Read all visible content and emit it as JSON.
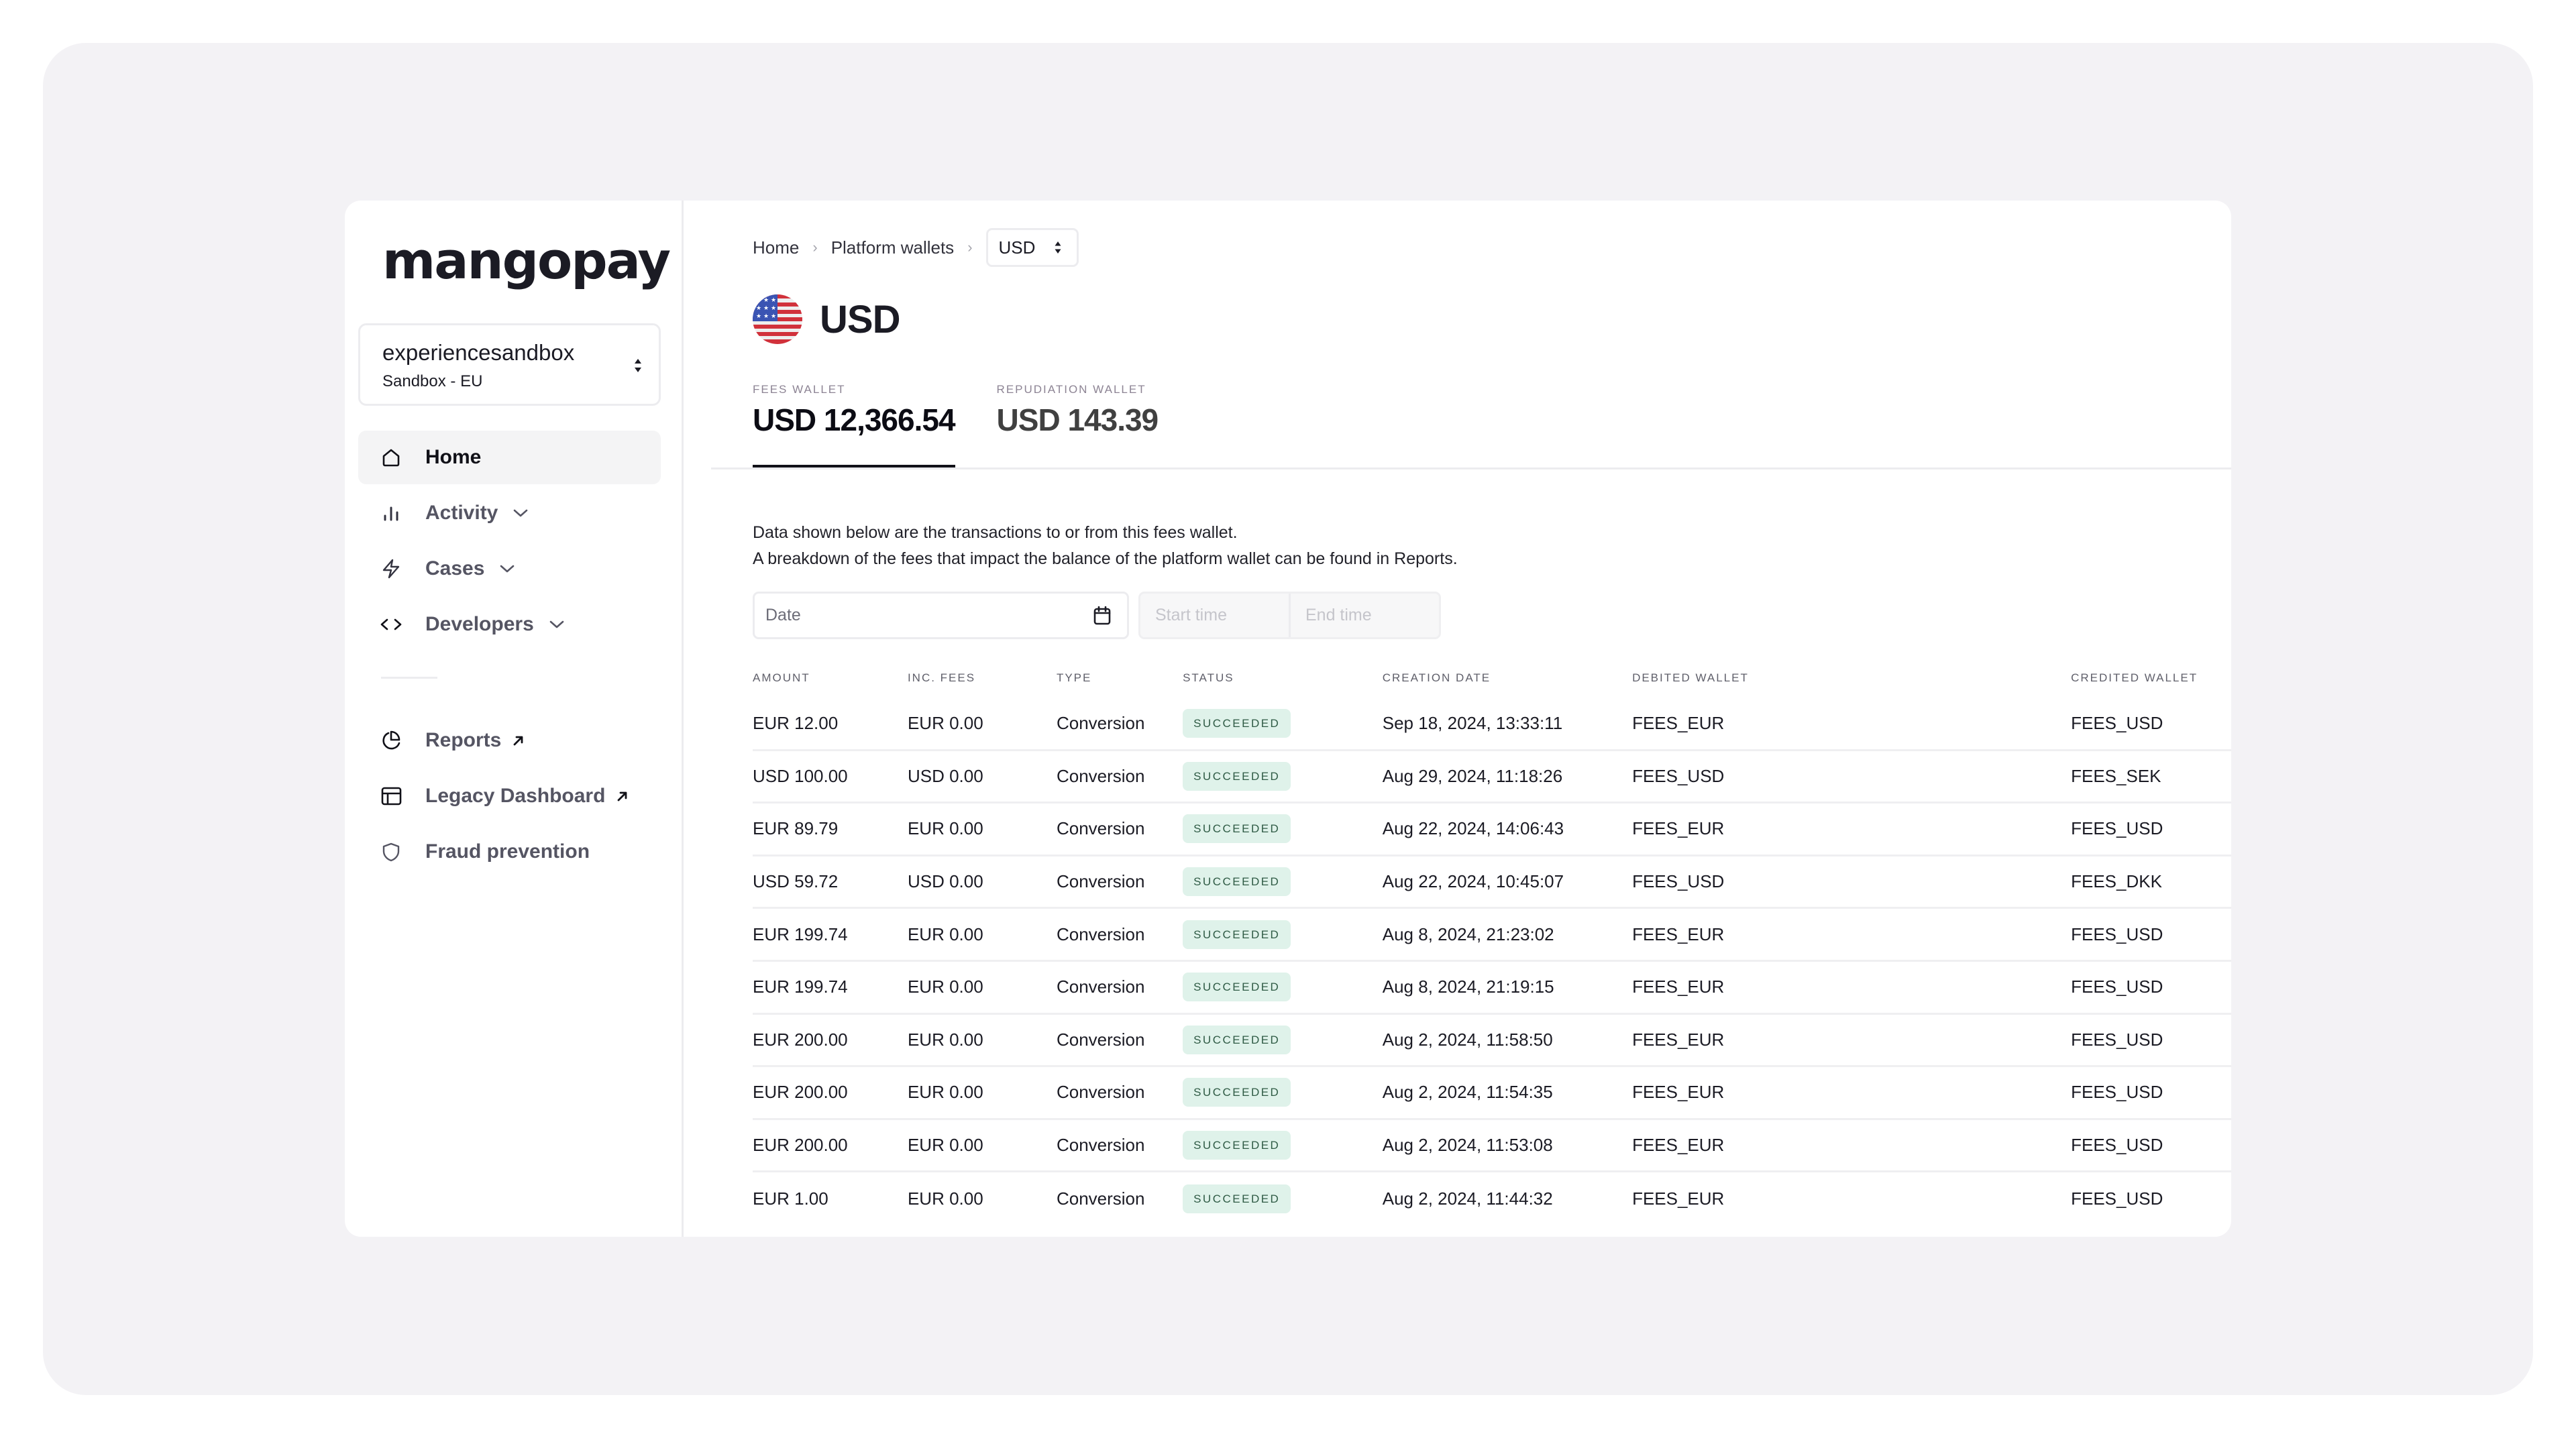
{
  "brand": {
    "logo_text": "mangopay"
  },
  "environment": {
    "name": "experiencesandbox",
    "region": "Sandbox - EU"
  },
  "sidebar": {
    "items": [
      {
        "label": "Home",
        "icon": "home-icon",
        "active": true,
        "expandable": false,
        "external": false
      },
      {
        "label": "Activity",
        "icon": "bar-chart-icon",
        "active": false,
        "expandable": true,
        "external": false
      },
      {
        "label": "Cases",
        "icon": "lightning-icon",
        "active": false,
        "expandable": true,
        "external": false
      },
      {
        "label": "Developers",
        "icon": "code-icon",
        "active": false,
        "expandable": true,
        "external": false
      }
    ],
    "secondary_items": [
      {
        "label": "Reports",
        "icon": "pie-chart-icon",
        "external": true
      },
      {
        "label": "Legacy Dashboard",
        "icon": "layout-icon",
        "external": true
      },
      {
        "label": "Fraud prevention",
        "icon": "shield-icon",
        "external": false
      }
    ]
  },
  "breadcrumb": {
    "items": [
      "Home",
      "Platform wallets"
    ],
    "currency_select": "USD"
  },
  "page": {
    "title": "USD",
    "flag": "us-flag-icon"
  },
  "wallets": [
    {
      "label": "FEES WALLET",
      "amount": "USD 12,366.54",
      "active": true
    },
    {
      "label": "REPUDIATION WALLET",
      "amount": "USD 143.39",
      "active": false
    }
  ],
  "description": [
    "Data shown below are the transactions to or from this fees wallet.",
    "A breakdown of the fees that impact the balance of the platform wallet can be found in Reports."
  ],
  "filters": {
    "date_placeholder": "Date",
    "start_time_placeholder": "Start time",
    "end_time_placeholder": "End time"
  },
  "table": {
    "columns": [
      "AMOUNT",
      "INC. FEES",
      "TYPE",
      "STATUS",
      "CREATION DATE",
      "DEBITED WALLET",
      "CREDITED WALLET"
    ],
    "rows": [
      {
        "amount": "EUR 12.00",
        "fees": "EUR 0.00",
        "type": "Conversion",
        "status": "SUCCEEDED",
        "date": "Sep 18, 2024, 13:33:11",
        "debited": "FEES_EUR",
        "credited": "FEES_USD"
      },
      {
        "amount": "USD 100.00",
        "fees": "USD 0.00",
        "type": "Conversion",
        "status": "SUCCEEDED",
        "date": "Aug 29, 2024, 11:18:26",
        "debited": "FEES_USD",
        "credited": "FEES_SEK"
      },
      {
        "amount": "EUR 89.79",
        "fees": "EUR 0.00",
        "type": "Conversion",
        "status": "SUCCEEDED",
        "date": "Aug 22, 2024, 14:06:43",
        "debited": "FEES_EUR",
        "credited": "FEES_USD"
      },
      {
        "amount": "USD 59.72",
        "fees": "USD 0.00",
        "type": "Conversion",
        "status": "SUCCEEDED",
        "date": "Aug 22, 2024, 10:45:07",
        "debited": "FEES_USD",
        "credited": "FEES_DKK"
      },
      {
        "amount": "EUR 199.74",
        "fees": "EUR 0.00",
        "type": "Conversion",
        "status": "SUCCEEDED",
        "date": "Aug 8, 2024, 21:23:02",
        "debited": "FEES_EUR",
        "credited": "FEES_USD"
      },
      {
        "amount": "EUR 199.74",
        "fees": "EUR 0.00",
        "type": "Conversion",
        "status": "SUCCEEDED",
        "date": "Aug 8, 2024, 21:19:15",
        "debited": "FEES_EUR",
        "credited": "FEES_USD"
      },
      {
        "amount": "EUR 200.00",
        "fees": "EUR 0.00",
        "type": "Conversion",
        "status": "SUCCEEDED",
        "date": "Aug 2, 2024, 11:58:50",
        "debited": "FEES_EUR",
        "credited": "FEES_USD"
      },
      {
        "amount": "EUR 200.00",
        "fees": "EUR 0.00",
        "type": "Conversion",
        "status": "SUCCEEDED",
        "date": "Aug 2, 2024, 11:54:35",
        "debited": "FEES_EUR",
        "credited": "FEES_USD"
      },
      {
        "amount": "EUR 200.00",
        "fees": "EUR 0.00",
        "type": "Conversion",
        "status": "SUCCEEDED",
        "date": "Aug 2, 2024, 11:53:08",
        "debited": "FEES_EUR",
        "credited": "FEES_USD"
      },
      {
        "amount": "EUR 1.00",
        "fees": "EUR 0.00",
        "type": "Conversion",
        "status": "SUCCEEDED",
        "date": "Aug 2, 2024, 11:44:32",
        "debited": "FEES_EUR",
        "credited": "FEES_USD"
      }
    ]
  },
  "colors": {
    "page_bg": "#f3f2f5",
    "success_badge_bg": "#dff2ea",
    "success_badge_text": "#2f5b45",
    "text_primary": "#1b1b24"
  }
}
